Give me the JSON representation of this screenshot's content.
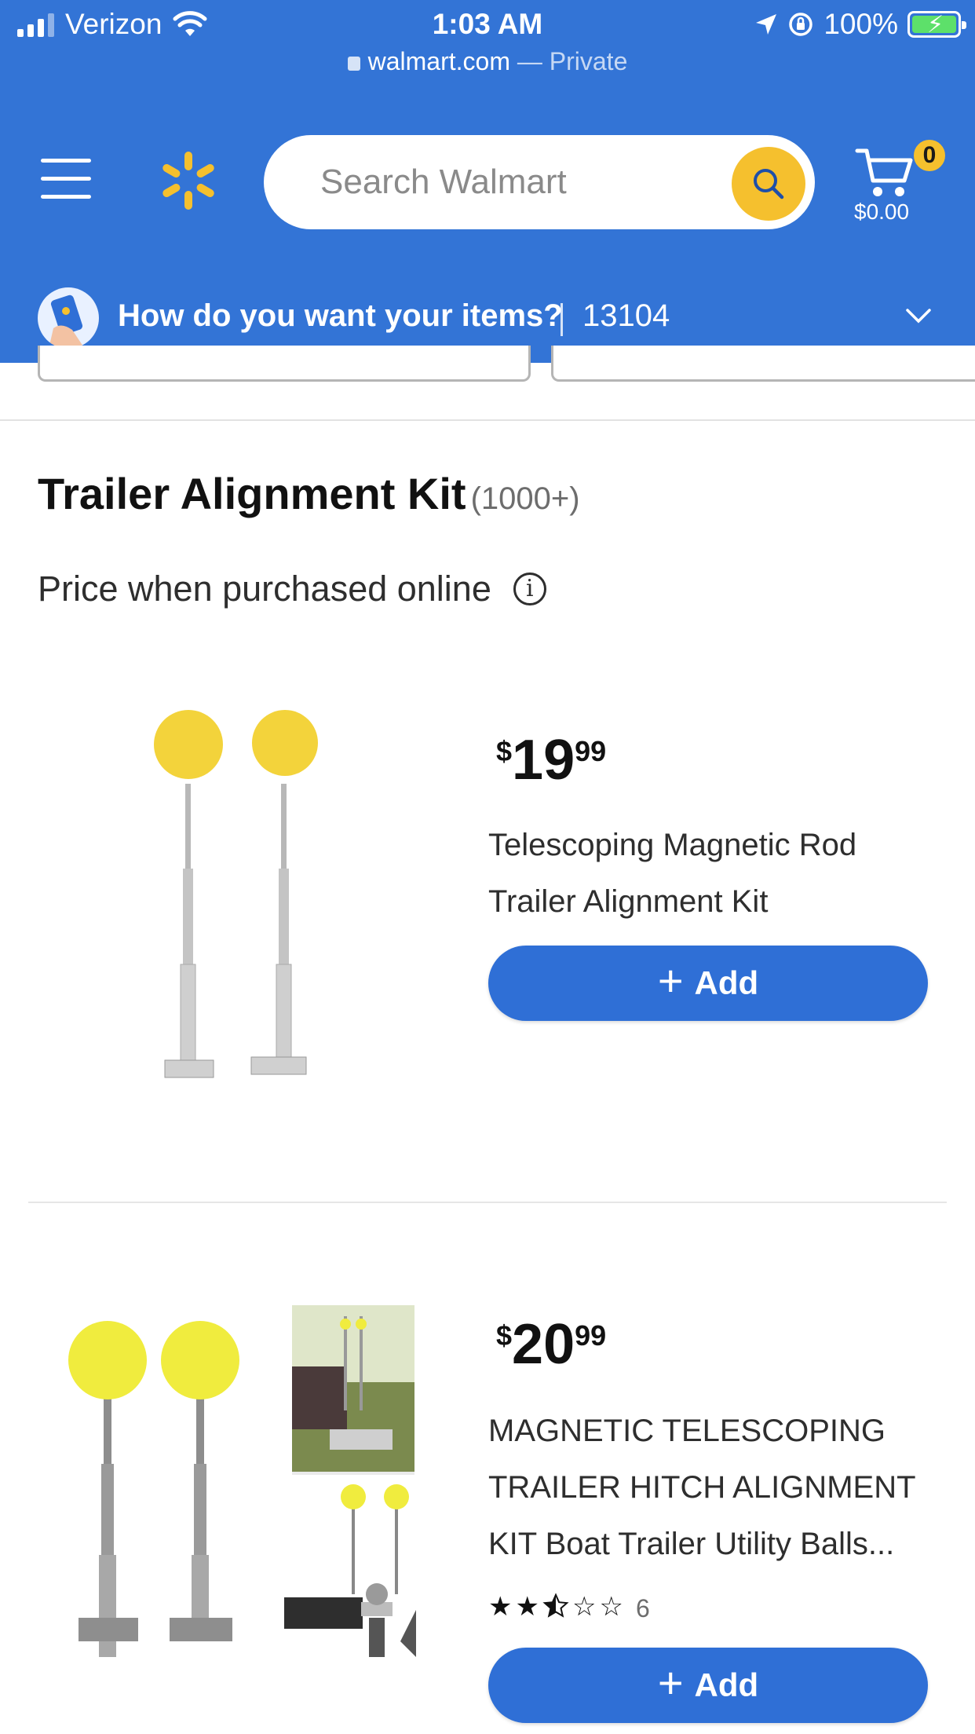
{
  "status_bar": {
    "carrier": "Verizon",
    "time": "1:03 AM",
    "battery": "100%"
  },
  "browser": {
    "domain": "walmart.com",
    "mode": "— Private"
  },
  "header": {
    "search_placeholder": "Search Walmart",
    "cart_count": "0",
    "cart_total": "$0.00",
    "fulfillment_prompt": "How do you want your items?",
    "zip_code": "13104",
    "brand_color": "#3374d6",
    "accent_color": "#f5c02e"
  },
  "results": {
    "title": "Trailer Alignment Kit",
    "count": "(1000+)",
    "price_note": "Price when purchased online",
    "info_icon": "i"
  },
  "products": [
    {
      "currency": "$",
      "dollars": "19",
      "cents": "99",
      "title_line1": "Telescoping Magnetic Rod",
      "title_line2": "Trailer Alignment Kit",
      "add_label": "Add"
    },
    {
      "currency": "$",
      "dollars": "20",
      "cents": "99",
      "title_line1": "MAGNETIC TELESCOPING",
      "title_line2": "TRAILER HITCH ALIGNMENT",
      "title_line3": "KIT Boat Trailer Utility Balls...",
      "rating": 2.5,
      "rating_max": 5,
      "review_count": "6",
      "add_label": "Add"
    }
  ]
}
